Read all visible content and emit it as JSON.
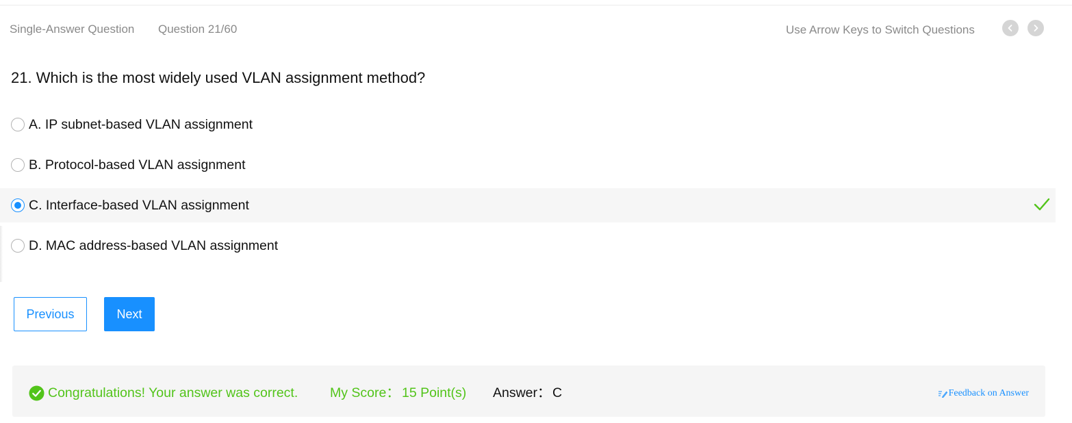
{
  "header": {
    "question_type": "Single-Answer Question",
    "question_index": "Question 21/60",
    "hint": "Use Arrow Keys to Switch Questions",
    "prev_icon": "chevron-left-icon",
    "next_icon": "chevron-right-icon"
  },
  "question": {
    "text": "21. Which is the most widely used VLAN assignment method?"
  },
  "options": [
    {
      "label": "A. IP subnet-based VLAN assignment",
      "selected": false
    },
    {
      "label": "B. Protocol-based VLAN assignment",
      "selected": false
    },
    {
      "label": "C. Interface-based VLAN assignment",
      "selected": true,
      "correct_icon": "checkmark-icon"
    },
    {
      "label": "D. MAC address-based VLAN assignment",
      "selected": false
    }
  ],
  "buttons": {
    "previous": "Previous",
    "next": "Next"
  },
  "result": {
    "message": "Congratulations! Your answer was correct.",
    "score_label": "My Score：",
    "score_value": "15 Point(s)",
    "answer_label": "Answer：",
    "answer_value": "C",
    "feedback": "Feedback on Answer",
    "feedback_icon": "edit-icon",
    "status_icon": "check-circle-icon"
  },
  "colors": {
    "accent": "#1890ff",
    "success": "#52c41a",
    "muted_text": "#8a8a8a",
    "selected_row_bg": "#f6f6f6",
    "result_bg": "#f5f5f5"
  }
}
